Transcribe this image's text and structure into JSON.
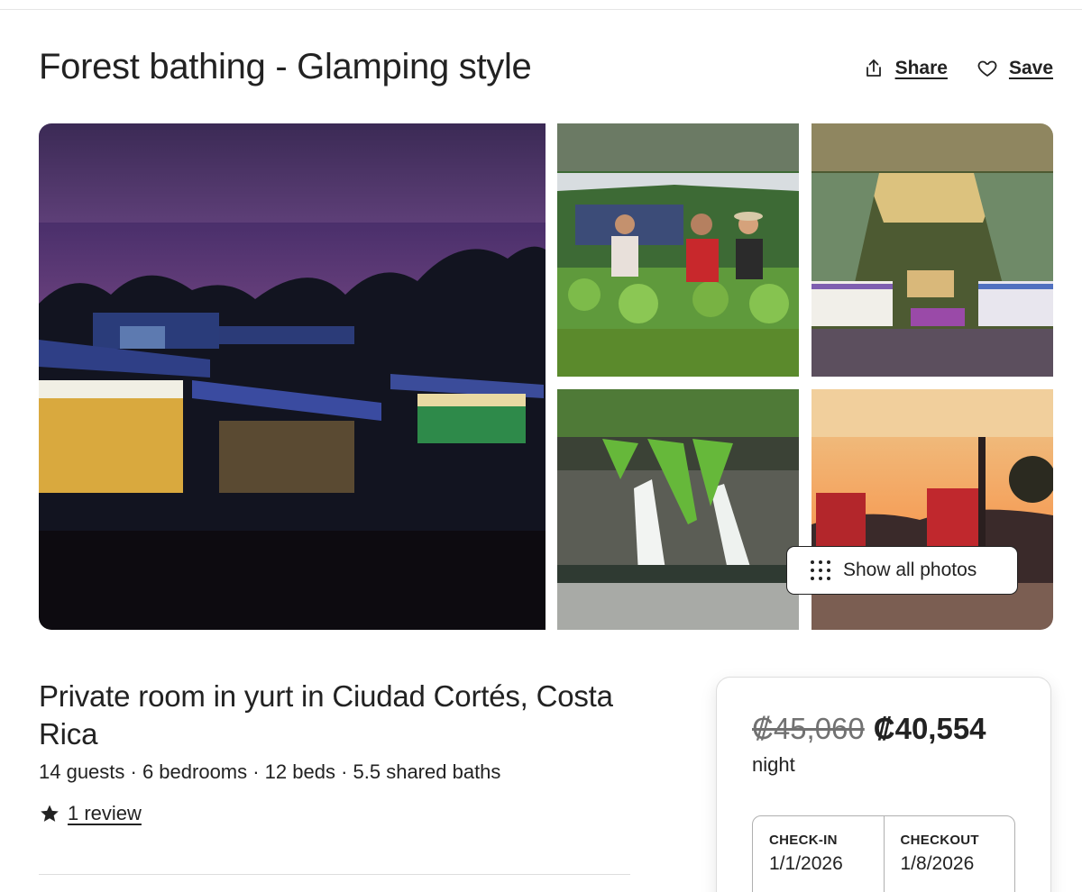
{
  "header": {
    "title": "Forest bathing - Glamping style",
    "share_label": "Share",
    "save_label": "Save",
    "share_icon": "share-icon",
    "save_icon": "heart-icon"
  },
  "gallery": {
    "show_all_label": "Show all photos"
  },
  "listing": {
    "title": "Private room in yurt in Ciudad Cortés, Costa Rica",
    "details": "14 guests · 6 bedrooms · 12 beds · 5.5 shared baths",
    "review_link": "1 review",
    "star_icon": "star-icon"
  },
  "booking": {
    "old_price": "₡45,060",
    "price": "₡40,554",
    "per": "night",
    "checkin_label": "CHECK-IN",
    "checkin_value": "1/1/2026",
    "checkout_label": "CHECKOUT",
    "checkout_value": "1/8/2026"
  },
  "colors": {
    "text": "#222222",
    "muted": "#717171",
    "border": "#dddddd"
  }
}
